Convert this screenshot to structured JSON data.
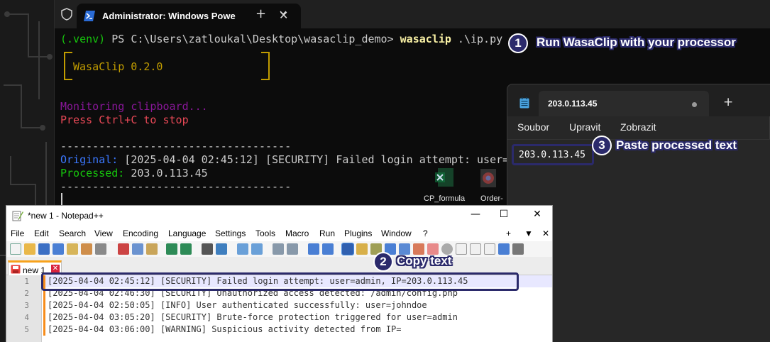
{
  "terminal": {
    "tab_title": "Administrator: Windows Powe",
    "new_tab": "+",
    "close_tab": "✕",
    "prompt_env": "(.venv)",
    "prompt_path": " PS C:\\Users\\zatloukal\\Desktop\\wasaclip_demo> ",
    "prompt_cmd": "wasaclip",
    "prompt_arg": " .\\ip.py",
    "banner": "WasaClip 0.2.0",
    "monitoring": "Monitoring clipboard...",
    "stop_hint": "Press Ctrl+C to stop",
    "separator": "------------------------------------",
    "original_label": "Original:",
    "original_value": " [2025-04-04 02:45:12] [SECURITY] Failed login attempt: user=",
    "processed_label": "Processed:",
    "processed_value": " 203.0.113.45"
  },
  "desktop": {
    "icon1_label": "CP_formula",
    "icon2_label": "Order-"
  },
  "notepad": {
    "tab_title": "203.0.113.45",
    "new_tab": "+",
    "menu": [
      "Soubor",
      "Upravit",
      "Zobrazit"
    ],
    "content": "203.0.113.45"
  },
  "npp": {
    "title": "*new 1 - Notepad++",
    "minimize": "—",
    "maximize": "☐",
    "close": "✕",
    "menu": [
      "File",
      "Edit",
      "Search",
      "View",
      "Encoding",
      "Language",
      "Settings",
      "Tools",
      "Macro",
      "Run",
      "Plugins",
      "Window",
      "?"
    ],
    "menu_right": [
      "+",
      "▼",
      "✕"
    ],
    "doc_tab": "new 1",
    "doc_tab_close": "✕",
    "line_numbers": [
      "1",
      "2",
      "3",
      "4",
      "5"
    ],
    "lines": [
      "[2025-04-04 02:45:12] [SECURITY] Failed login attempt: user=admin, IP=203.0.113.45",
      "[2025-04-04 02:46:30] [SECURITY] Unauthorized access detected: /admin/config.php",
      "[2025-04-04 02:50:05] [INFO] User authenticated successfully: user=johndoe",
      "[2025-04-04 03:05:20] [SECURITY] Brute-force protection triggered for user=admin",
      "[2025-04-04 03:06:00] [WARNING] Suspicious activity detected from IP="
    ]
  },
  "annotations": {
    "step1_num": "1",
    "step1_text": "Run WasaClip with your processor",
    "step2_num": "2",
    "step2_text": "Copy text",
    "step3_num": "3",
    "step3_text": "Paste processed text"
  },
  "colors": {
    "annotation": "#2b2a6b",
    "terminal_bg": "#0c0c0c",
    "prompt_green": "#16c60c",
    "banner_gold": "#c19c00",
    "monitor_purple": "#881798",
    "stop_red": "#e74856",
    "label_blue": "#3b78ff"
  }
}
